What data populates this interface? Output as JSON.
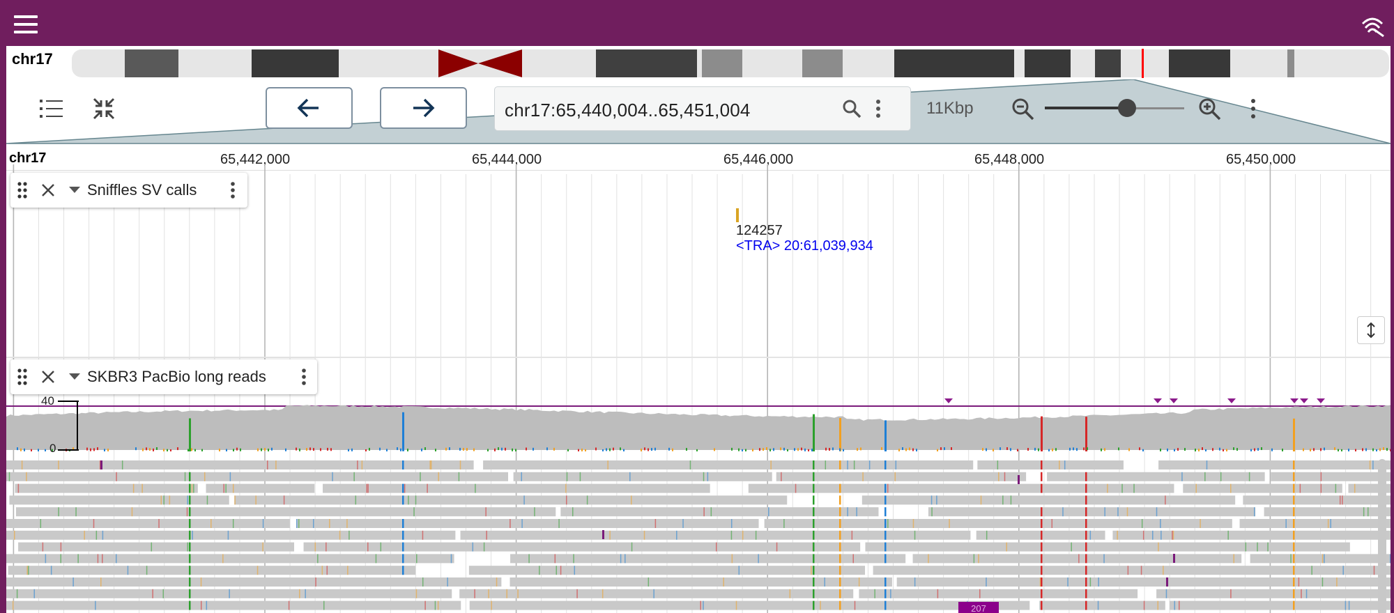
{
  "app": {
    "menu_icon": "hamburger-menu-icon",
    "connection_icon": "connection-signal-icon",
    "bar_color": "#701e5e"
  },
  "ideogram": {
    "chromosome": "chr17",
    "highlight_color": "#ff0000"
  },
  "toolbar": {
    "track_list_icon": "track-list-icon",
    "minimize_icon": "collapse-arrows-icon",
    "back_icon": "arrow-left-icon",
    "forward_icon": "arrow-right-icon",
    "location": "chr17:65,440,004..65,451,004",
    "search_icon": "search-icon",
    "search_menu_icon": "vertical-dots-icon",
    "span": "11Kbp",
    "zoom_out_icon": "zoom-out-icon",
    "zoom_in_icon": "zoom-in-icon",
    "zoom_level": 0.59,
    "view_menu_icon": "vertical-dots-icon"
  },
  "ruler": {
    "chromosome": "chr17",
    "ticks": [
      "65,442,000",
      "65,444,000",
      "65,446,000",
      "65,448,000",
      "65,450,000"
    ]
  },
  "tracks": [
    {
      "title": "Sniffles SV calls",
      "drag_icon": "drag-handle-icon",
      "close_icon": "close-icon",
      "expand_icon": "triangle-down-icon",
      "menu_icon": "vertical-dots-icon",
      "feature": {
        "name": "124257",
        "description": "<TRA> 20:61,039,934",
        "color": "#d9a424",
        "description_color": "#0000ee"
      }
    },
    {
      "title": "SKBR3 PacBio long reads",
      "drag_icon": "drag-handle-icon",
      "close_icon": "close-icon",
      "expand_icon": "triangle-down-icon",
      "menu_icon": "vertical-dots-icon",
      "coverage_max": "40",
      "coverage_min": "0",
      "read_label": "207"
    }
  ],
  "resize_icon": "vertical-resize-icon"
}
